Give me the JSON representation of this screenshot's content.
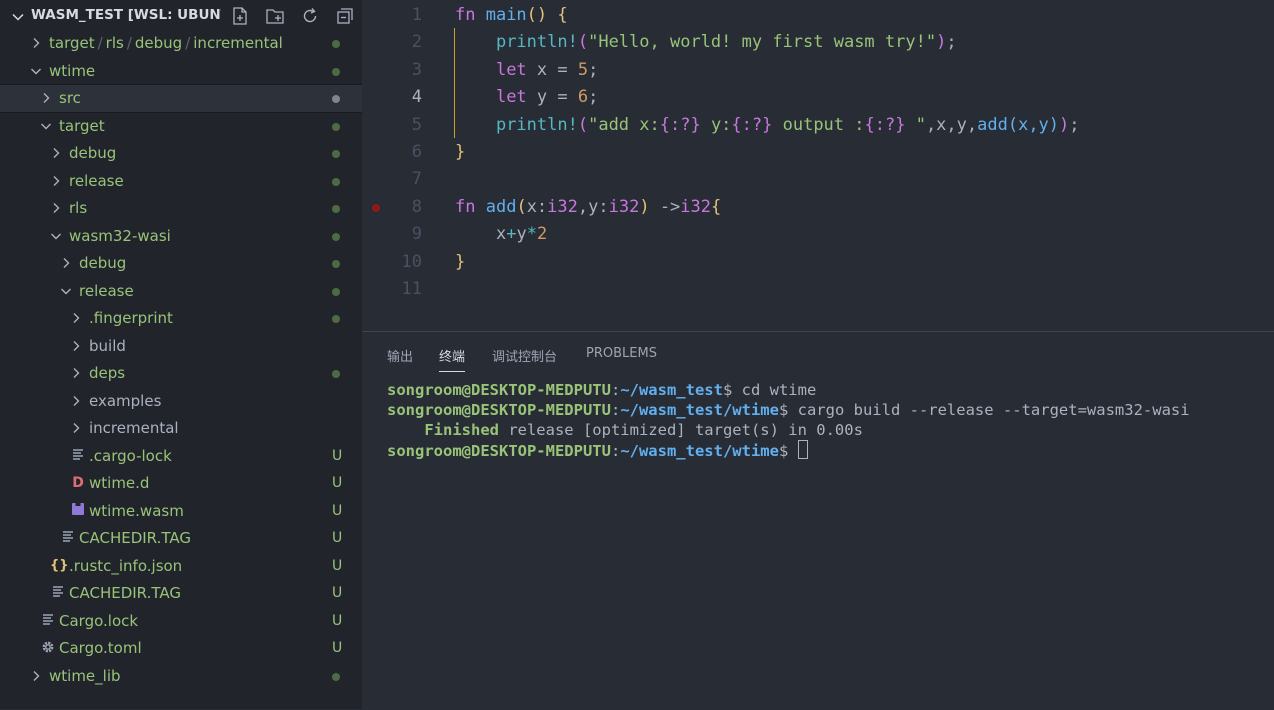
{
  "explorer": {
    "title": "WASM_TEST [WSL: UBUNT...",
    "actions": [
      "new-file-icon",
      "new-folder-icon",
      "refresh-icon",
      "collapse-all-icon"
    ],
    "items": [
      {
        "path": [
          "target",
          "rls",
          "debug",
          "incremental"
        ],
        "type": "folder",
        "expanded": false,
        "depth": 0,
        "status": "dot"
      },
      {
        "label": "wtime",
        "type": "folder",
        "expanded": true,
        "depth": 0,
        "status": "dot"
      },
      {
        "label": "src",
        "type": "folder",
        "expanded": false,
        "depth": 1,
        "status": "dot-gray",
        "selected": true
      },
      {
        "label": "target",
        "type": "folder",
        "expanded": true,
        "depth": 1,
        "status": "dot"
      },
      {
        "label": "debug",
        "type": "folder",
        "expanded": false,
        "depth": 2,
        "status": "dot"
      },
      {
        "label": "release",
        "type": "folder",
        "expanded": false,
        "depth": 2,
        "status": "dot"
      },
      {
        "label": "rls",
        "type": "folder",
        "expanded": false,
        "depth": 2,
        "status": "dot"
      },
      {
        "label": "wasm32-wasi",
        "type": "folder",
        "expanded": true,
        "depth": 2,
        "status": "dot"
      },
      {
        "label": "debug",
        "type": "folder",
        "expanded": false,
        "depth": 3,
        "status": "dot"
      },
      {
        "label": "release",
        "type": "folder",
        "expanded": true,
        "depth": 3,
        "status": "dot"
      },
      {
        "label": ".fingerprint",
        "type": "folder",
        "expanded": false,
        "depth": 4,
        "status": "dot"
      },
      {
        "label": "build",
        "type": "folder",
        "expanded": false,
        "depth": 4,
        "status": "none"
      },
      {
        "label": "deps",
        "type": "folder",
        "expanded": false,
        "depth": 4,
        "status": "dot"
      },
      {
        "label": "examples",
        "type": "folder",
        "expanded": false,
        "depth": 4,
        "status": "none"
      },
      {
        "label": "incremental",
        "type": "folder",
        "expanded": false,
        "depth": 4,
        "status": "none"
      },
      {
        "label": ".cargo-lock",
        "type": "file",
        "icon": "lines",
        "depth": 4,
        "status": "U"
      },
      {
        "label": "wtime.d",
        "type": "file",
        "icon": "d",
        "depth": 4,
        "status": "U"
      },
      {
        "label": "wtime.wasm",
        "type": "file",
        "icon": "wasm",
        "depth": 4,
        "status": "U"
      },
      {
        "label": "CACHEDIR.TAG",
        "type": "file",
        "icon": "lines",
        "depth": 3,
        "status": "U"
      },
      {
        "label": ".rustc_info.json",
        "type": "file",
        "icon": "json",
        "depth": 2,
        "status": "U"
      },
      {
        "label": "CACHEDIR.TAG",
        "type": "file",
        "icon": "lines",
        "depth": 2,
        "status": "U"
      },
      {
        "label": "Cargo.lock",
        "type": "file",
        "icon": "lines",
        "depth": 1,
        "status": "U"
      },
      {
        "label": "Cargo.toml",
        "type": "file",
        "icon": "gear",
        "depth": 1,
        "status": "U"
      },
      {
        "label": "wtime_lib",
        "type": "folder",
        "expanded": false,
        "depth": 0,
        "status": "dot"
      }
    ]
  },
  "editor": {
    "active_line": 4,
    "breakpoint_line": 8,
    "lines": [
      {
        "num": "1",
        "tokens": [
          [
            "kw",
            "fn "
          ],
          [
            "fn",
            "main"
          ],
          [
            "br",
            "()"
          ],
          [
            "p",
            " "
          ],
          [
            "br",
            "{"
          ]
        ]
      },
      {
        "num": "2",
        "tokens": [
          [
            "p",
            "    "
          ],
          [
            "mac",
            "println!"
          ],
          [
            "br2",
            "("
          ],
          [
            "str",
            "\"Hello, world! my first wasm try!\""
          ],
          [
            "br2",
            ")"
          ],
          [
            "p",
            ";"
          ]
        ]
      },
      {
        "num": "3",
        "tokens": [
          [
            "p",
            "    "
          ],
          [
            "kw",
            "let"
          ],
          [
            "p",
            " x = "
          ],
          [
            "num",
            "5"
          ],
          [
            "p",
            ";"
          ]
        ]
      },
      {
        "num": "4",
        "tokens": [
          [
            "p",
            "    "
          ],
          [
            "kw",
            "let"
          ],
          [
            "p",
            " y = "
          ],
          [
            "num",
            "6"
          ],
          [
            "p",
            ";"
          ]
        ]
      },
      {
        "num": "5",
        "tokens": [
          [
            "p",
            "    "
          ],
          [
            "mac",
            "println!"
          ],
          [
            "br2",
            "("
          ],
          [
            "str",
            "\"add x:"
          ],
          [
            "fmt",
            "{:?}"
          ],
          [
            "str",
            " y:"
          ],
          [
            "fmt",
            "{:?}"
          ],
          [
            "str",
            " output :"
          ],
          [
            "fmt",
            "{:?}"
          ],
          [
            "str",
            " \""
          ],
          [
            "p",
            ",x,y,"
          ],
          [
            "fn",
            "add"
          ],
          [
            "fn",
            "(x,y)"
          ],
          [
            "br2",
            ")"
          ],
          [
            "p",
            ";"
          ]
        ]
      },
      {
        "num": "6",
        "tokens": [
          [
            "br",
            "}"
          ]
        ]
      },
      {
        "num": "7",
        "tokens": []
      },
      {
        "num": "8",
        "tokens": [
          [
            "kw",
            "fn "
          ],
          [
            "fn",
            "add"
          ],
          [
            "br",
            "("
          ],
          [
            "p",
            "x:"
          ],
          [
            "typ",
            "i32"
          ],
          [
            "p",
            ",y:"
          ],
          [
            "typ",
            "i32"
          ],
          [
            "br",
            ")"
          ],
          [
            "p",
            " ->"
          ],
          [
            "typ",
            "i32"
          ],
          [
            "br",
            "{"
          ]
        ]
      },
      {
        "num": "9",
        "tokens": [
          [
            "p",
            "    x"
          ],
          [
            "op",
            "+"
          ],
          [
            "p",
            "y"
          ],
          [
            "op",
            "*"
          ],
          [
            "num",
            "2"
          ]
        ]
      },
      {
        "num": "10",
        "tokens": [
          [
            "br",
            "}"
          ]
        ]
      },
      {
        "num": "11",
        "tokens": []
      }
    ]
  },
  "panel": {
    "tabs": [
      {
        "label": "输出",
        "active": false
      },
      {
        "label": "终端",
        "active": true
      },
      {
        "label": "调试控制台",
        "active": false
      },
      {
        "label": "PROBLEMS",
        "active": false
      }
    ],
    "terminal": {
      "user_host": "songroom@DESKTOP-MEDPUTU",
      "lines": [
        {
          "kind": "prompt",
          "path": "~/wasm_test",
          "cmd": " cd wtime"
        },
        {
          "kind": "prompt",
          "path": "~/wasm_test/wtime",
          "cmd": " cargo build --release --target=wasm32-wasi"
        },
        {
          "kind": "output",
          "status": "Finished",
          "text": " release [optimized] target(s) in 0.00s"
        },
        {
          "kind": "prompt",
          "path": "~/wasm_test/wtime",
          "cmd": " ",
          "cursor": true
        }
      ]
    }
  }
}
